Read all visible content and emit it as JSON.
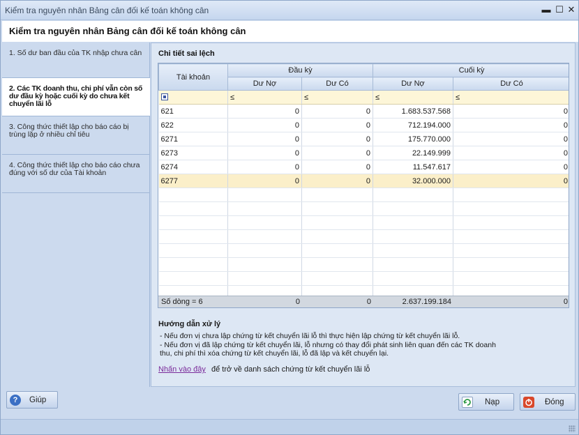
{
  "window": {
    "title": "Kiểm tra nguyên nhân Bảng cân đối kế toán không cân",
    "minimize_glyph": "▬",
    "maximize_glyph": "☐",
    "close_glyph": "✕"
  },
  "header": {
    "title": "Kiểm tra nguyên nhân Bảng cân đối kế toán không cân"
  },
  "steps": [
    {
      "label": "1. Số dư ban đầu của TK nhập chưa cân"
    },
    {
      "label": "2. Các TK doanh thu, chi phí vẫn còn số dư đầu kỳ hoặc cuối kỳ do chưa kết chuyển lãi lỗ"
    },
    {
      "label": "3. Công thức thiết lập cho báo cáo bị trùng lặp ở nhiều chỉ tiêu"
    },
    {
      "label": "4. Công thức thiết lập cho báo cáo chưa đúng với số dư của Tài khoản"
    }
  ],
  "detail": {
    "section_label": "Chi tiết sai lệch",
    "headers": {
      "account": "Tài khoản",
      "opening": "Đầu kỳ",
      "closing": "Cuối kỳ",
      "debit": "Dư Nợ",
      "credit": "Dư Có"
    },
    "filter_op": "≤",
    "rows": [
      {
        "account": "621",
        "open_debit": "0",
        "open_credit": "0",
        "close_debit": "1.683.537.568",
        "close_credit": "0"
      },
      {
        "account": "622",
        "open_debit": "0",
        "open_credit": "0",
        "close_debit": "712.194.000",
        "close_credit": "0"
      },
      {
        "account": "6271",
        "open_debit": "0",
        "open_credit": "0",
        "close_debit": "175.770.000",
        "close_credit": "0"
      },
      {
        "account": "6273",
        "open_debit": "0",
        "open_credit": "0",
        "close_debit": "22.149.999",
        "close_credit": "0"
      },
      {
        "account": "6274",
        "open_debit": "0",
        "open_credit": "0",
        "close_debit": "11.547.617",
        "close_credit": "0"
      },
      {
        "account": "6277",
        "open_debit": "0",
        "open_credit": "0",
        "close_debit": "32.000.000",
        "close_credit": "0"
      }
    ],
    "footer": {
      "count_label": "Số dòng = 6",
      "open_debit": "0",
      "open_credit": "0",
      "close_debit": "2.637.199.184",
      "close_credit": "0"
    }
  },
  "guide": {
    "title": "Hướng dẫn xử lý",
    "line1": " - Nếu đơn vị chưa lập chứng từ kết chuyển lãi lỗ thì thực hiện lập chứng từ kết chuyển lãi lỗ.",
    "line2": " - Nếu đơn vị đã lập chứng từ kết chuyển lãi, lỗ nhưng có thay đổi phát sinh liên quan đến các TK doanh",
    "line3": "thu, chi phí thì xóa chứng từ kết chuyển lãi, lỗ đã lập và kết chuyển lại.",
    "link_text": "Nhấn vào đây",
    "link_tail": "để trở về danh sách chứng từ kết chuyển lãi lỗ"
  },
  "buttons": {
    "help": "Giúp",
    "load": "Nạp",
    "close": "Đóng"
  },
  "colors": {
    "accent": "#3a6fc4",
    "close_icon": "#d9482b",
    "load_icon": "#2e9a45"
  }
}
